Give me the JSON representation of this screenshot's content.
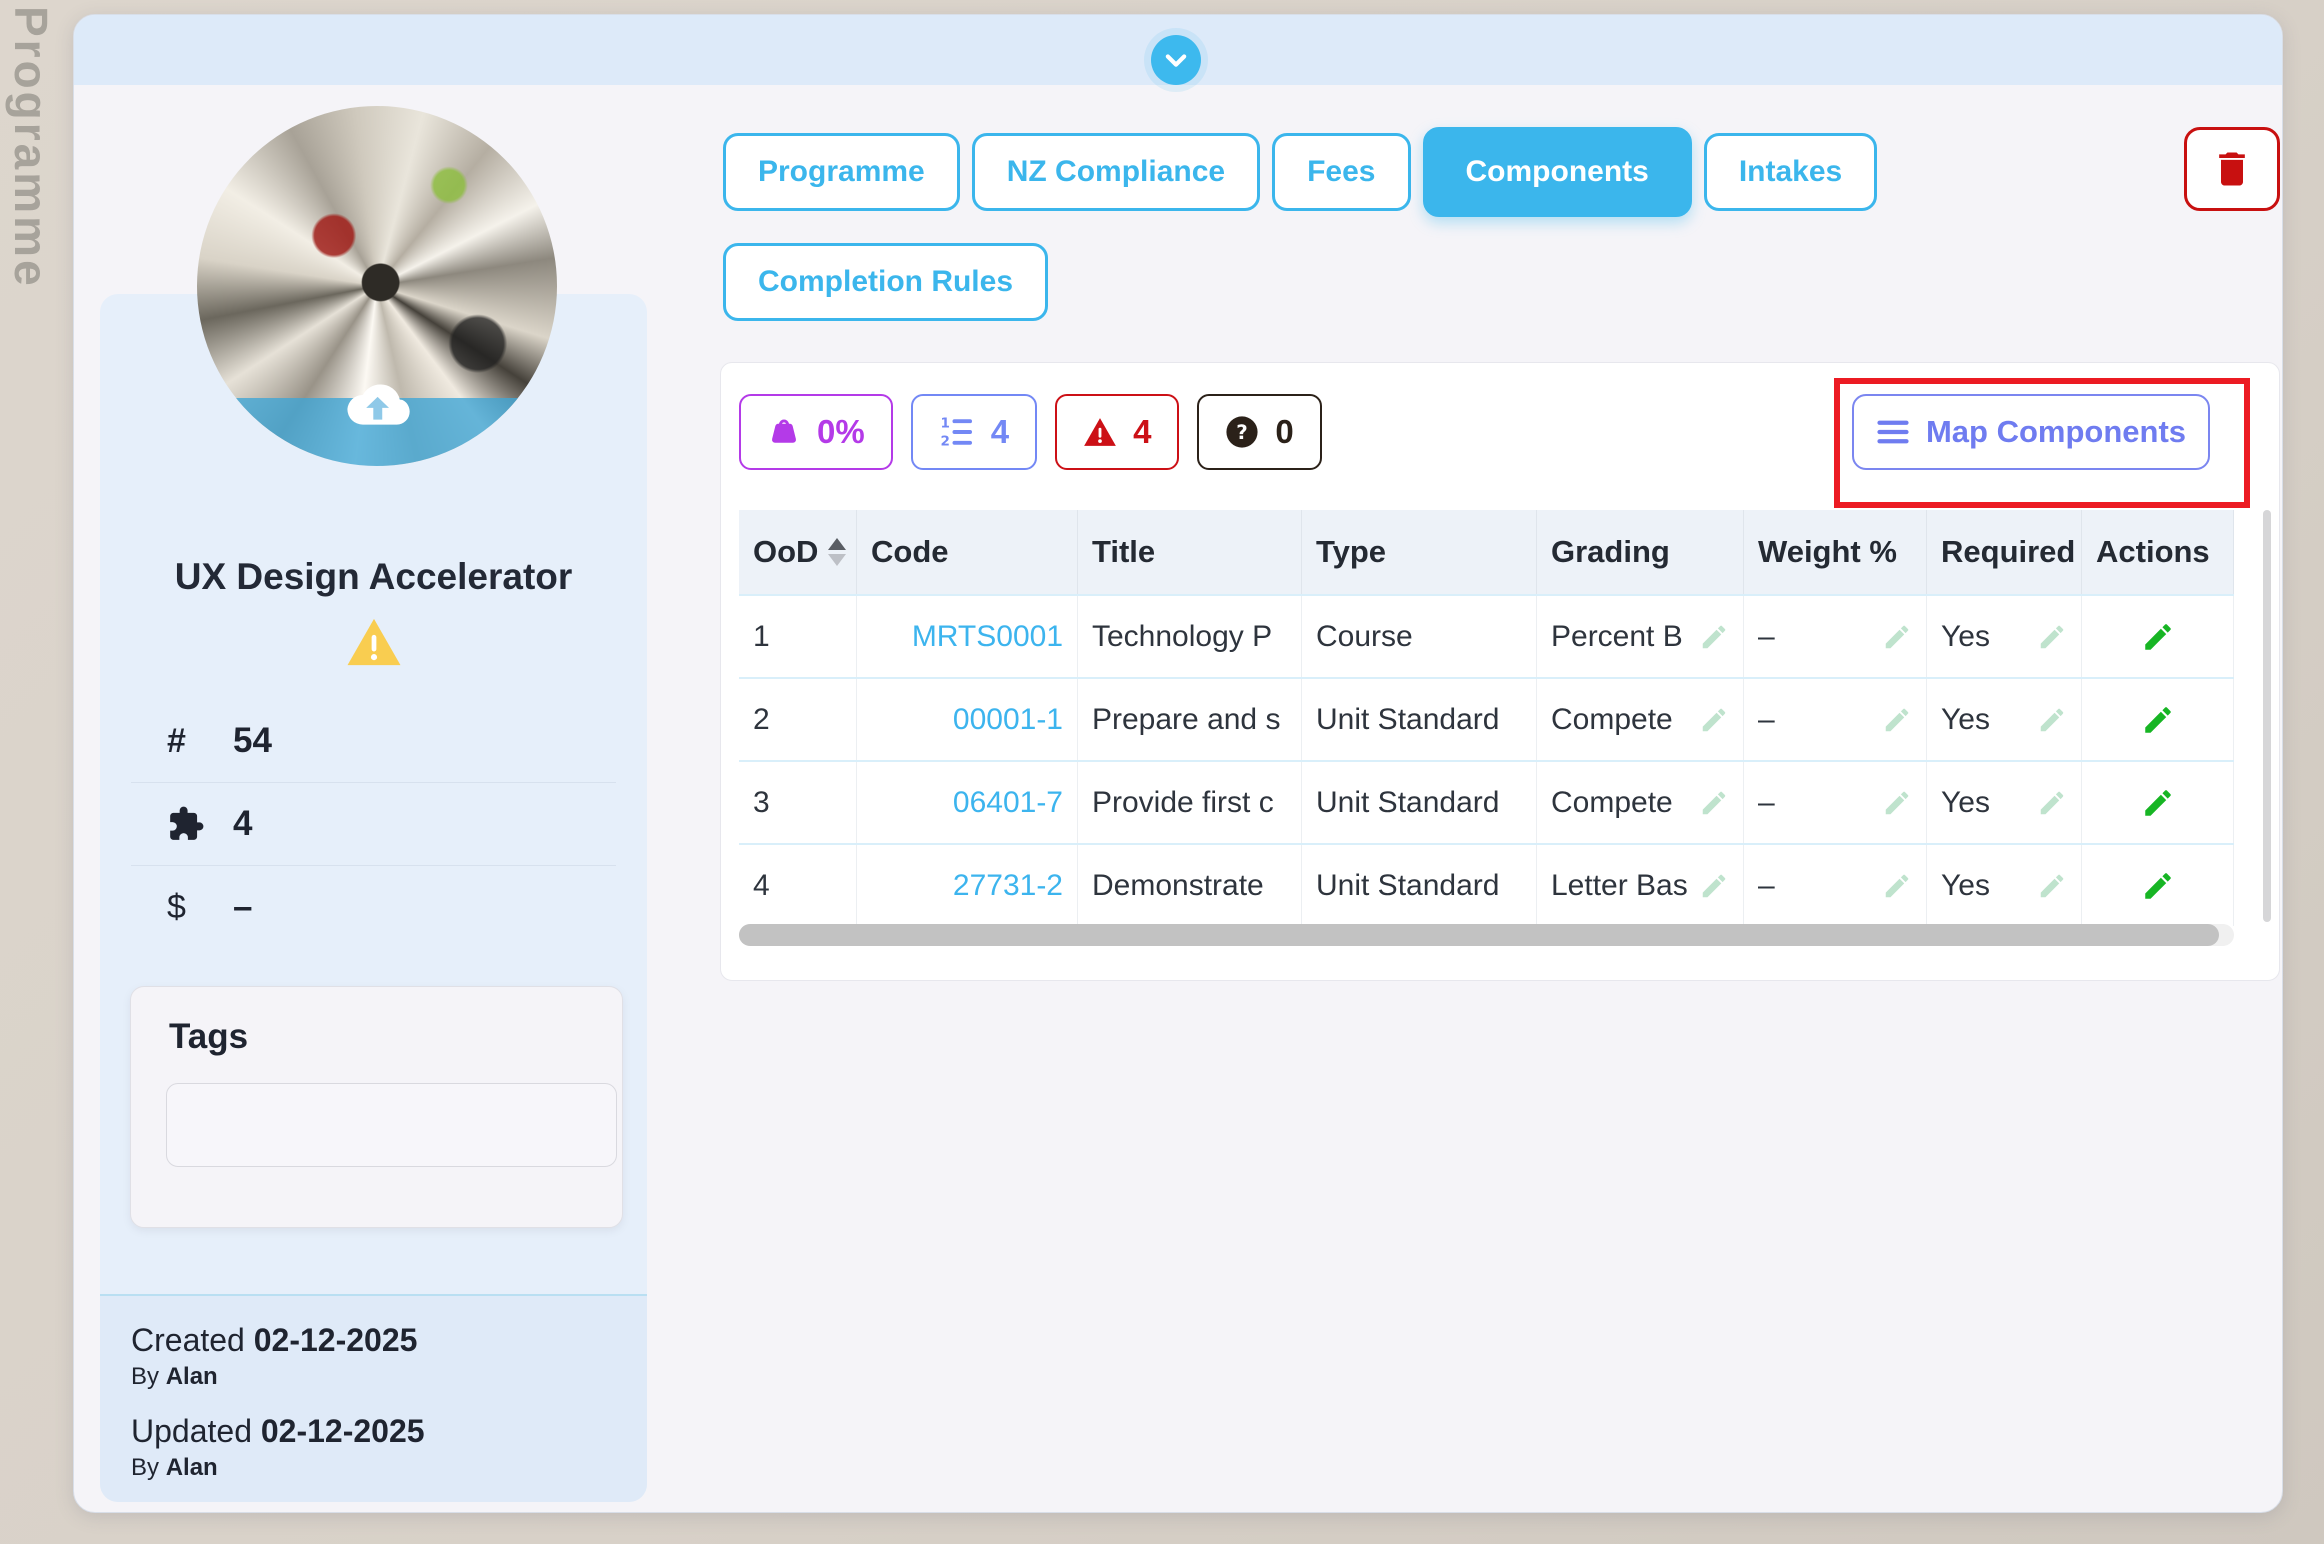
{
  "page": {
    "vertical_label": "Programme"
  },
  "colors": {
    "accent_blue": "#3bb6ec",
    "link_blue": "#3cb4ee",
    "badge_purple": "#b43ae8",
    "badge_indigo": "#7388f5",
    "badge_red": "#cc1016",
    "badge_dark": "#2b2119",
    "action_green": "#17b524",
    "edit_hint_green": "#bfe3cd",
    "highlight_red": "#ec1b23",
    "warning_yellow": "#f9cd50",
    "delete_red": "#c81010"
  },
  "tabs": [
    {
      "label": "Programme"
    },
    {
      "label": "NZ Compliance"
    },
    {
      "label": "Fees"
    },
    {
      "label": "Components",
      "active": true
    },
    {
      "label": "Intakes"
    },
    {
      "label": "Completion Rules"
    }
  ],
  "profile": {
    "title": "UX Design Accelerator",
    "stats": {
      "number": "54",
      "components_count": "4",
      "price": "–"
    },
    "tags_heading": "Tags",
    "tags_value": "",
    "created_label": "Created",
    "created_date": "02-12-2025",
    "created_by_label": "By",
    "created_by": "Alan",
    "updated_label": "Updated",
    "updated_date": "02-12-2025",
    "updated_by_label": "By",
    "updated_by": "Alan"
  },
  "components": {
    "badges": {
      "weight_percent": "0%",
      "list_count": "4",
      "warning_count": "4",
      "unknown_count": "0"
    },
    "map_button_label": "Map Components",
    "table": {
      "headers": [
        "OoD",
        "Code",
        "Title",
        "Type",
        "Grading",
        "Weight %",
        "Required",
        "Actions"
      ],
      "rows": [
        {
          "ood": "1",
          "code": "MRTS0001",
          "title": "Technology P",
          "type": "Course",
          "grading": "Percent B",
          "weight": "–",
          "required": "Yes"
        },
        {
          "ood": "2",
          "code": "00001-1",
          "title": "Prepare and s",
          "type": "Unit Standard",
          "grading": "Compete",
          "weight": "–",
          "required": "Yes"
        },
        {
          "ood": "3",
          "code": "06401-7",
          "title": "Provide first c",
          "type": "Unit Standard",
          "grading": "Compete",
          "weight": "–",
          "required": "Yes"
        },
        {
          "ood": "4",
          "code": "27731-2",
          "title": "Demonstrate",
          "type": "Unit Standard",
          "grading": "Letter Bas",
          "weight": "–",
          "required": "Yes"
        }
      ]
    }
  }
}
